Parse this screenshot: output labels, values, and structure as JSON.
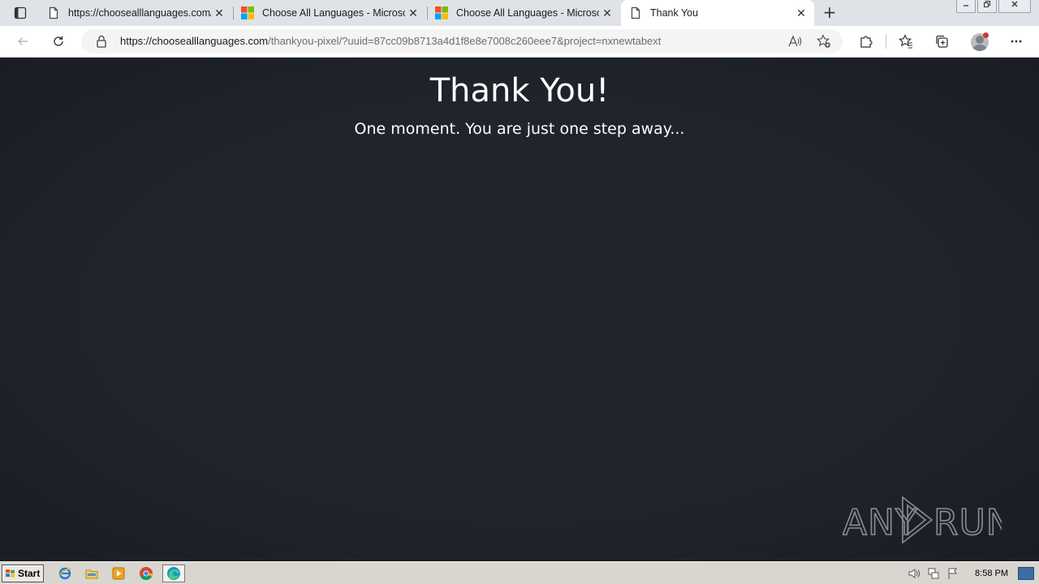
{
  "browser": {
    "tabs": [
      {
        "label": "https://choosealllanguages.com/",
        "favicon": "page-icon",
        "active": false
      },
      {
        "label": "Choose All Languages - Microsoft",
        "favicon": "microsoft-logo-icon",
        "active": false
      },
      {
        "label": "Choose All Languages - Microsoft",
        "favicon": "microsoft-logo-icon",
        "active": false
      },
      {
        "label": "Thank You",
        "favicon": "page-icon",
        "active": true
      }
    ],
    "close_glyph": "✕",
    "new_tab_glyph": "+",
    "address": {
      "host": "https://choosealllanguages.com",
      "path": "/thankyou-pixel/?uuid=87cc09b8713a4d1f8e8e7008c260eee7&project=nxnewtabext"
    }
  },
  "page": {
    "heading": "Thank You!",
    "subheading": "One moment. You are just one step away..."
  },
  "watermark": {
    "text_left": "ANY",
    "text_right": "RUN"
  },
  "taskbar": {
    "start_label": "Start",
    "clock": "8:58 PM"
  },
  "colors": {
    "page_background": "#1f232b",
    "text": "#ffffff",
    "tabstrip": "#dfe3e8",
    "taskbar": "#d9d5cf"
  }
}
